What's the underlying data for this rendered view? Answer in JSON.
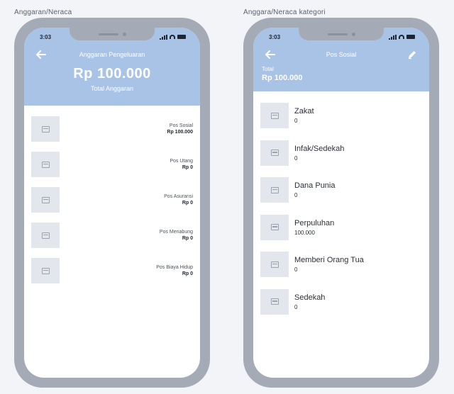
{
  "labels": {
    "left_frame": "Anggaran/Neraca",
    "right_frame": "Anggara/Neraca kategori"
  },
  "left_screen": {
    "status_time": "3:03",
    "title": "Anggaran Pengeluaran",
    "amount": "Rp 100.000",
    "amount_caption": "Total Anggaran",
    "items": [
      {
        "name": "Pos Sosial",
        "value": "Rp 100.000"
      },
      {
        "name": "Pos Utang",
        "value": "Rp 0"
      },
      {
        "name": "Pos Asuransi",
        "value": "Rp 0"
      },
      {
        "name": "Pos Menabung",
        "value": "Rp 0"
      },
      {
        "name": "Pos Biaya Hidup",
        "value": "Rp 0"
      }
    ]
  },
  "right_screen": {
    "status_time": "3:03",
    "title": "Pos Sosial",
    "total_label": "Total",
    "total_value": "Rp 100.000",
    "items": [
      {
        "name": "Zakat",
        "value": "0"
      },
      {
        "name": "Infak/Sedekah",
        "value": "0"
      },
      {
        "name": "Dana Punia",
        "value": "0"
      },
      {
        "name": "Perpuluhan",
        "value": "100.000"
      },
      {
        "name": "Memberi Orang Tua",
        "value": "0"
      },
      {
        "name": "Sedekah",
        "value": "0"
      }
    ]
  },
  "icons": {
    "back": "arrow-left-icon",
    "edit": "pencil-icon",
    "thumbnail": "image-placeholder-icon"
  },
  "colors": {
    "header": "#a9c3e6",
    "phone_frame": "#a4aab6",
    "thumbnail": "#e3e6ec"
  }
}
